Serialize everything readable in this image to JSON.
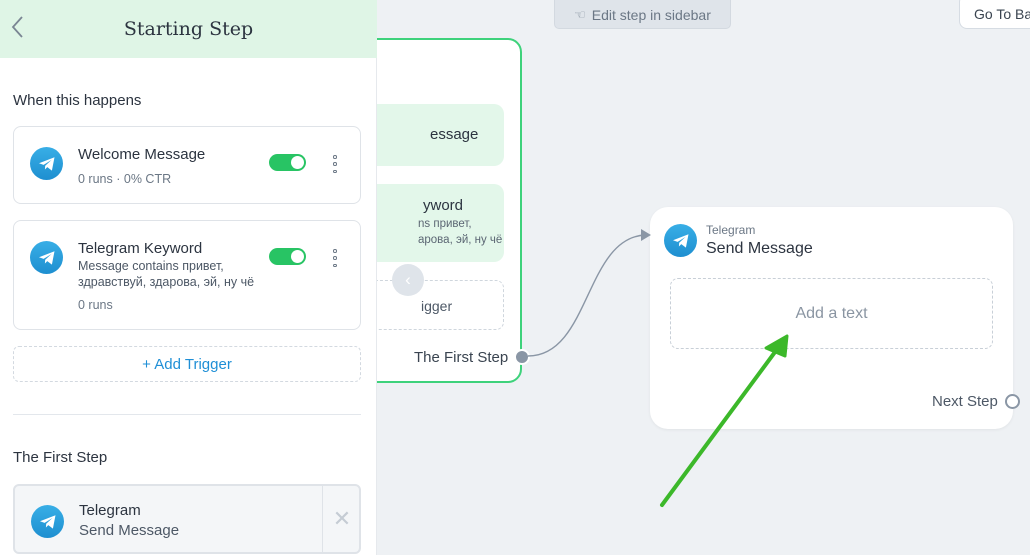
{
  "sidebar": {
    "title": "Starting Step",
    "back_icon": "chevron-left-icon",
    "when_label": "When this happens",
    "triggers": [
      {
        "name": "Welcome Message",
        "runs": "0 runs",
        "ctr": "0% CTR",
        "enabled": true
      },
      {
        "name": "Telegram Keyword",
        "description": "Message contains привет, здравствуй, здарова, эй, ну чё",
        "runs": "0 runs",
        "enabled": true
      }
    ],
    "add_trigger_label": "+ Add Trigger",
    "first_step_heading": "The First Step",
    "first_step_card": {
      "title": "Telegram",
      "subtitle": "Send Message",
      "remove_icon": "close-icon"
    }
  },
  "canvas": {
    "edit_hint": "Edit step in sidebar",
    "goto_button": "Go To Ba",
    "start_card": {
      "trigger_1_fragment": "essage",
      "trigger_2_fragment": "yword",
      "trigger_2_desc_fragment": "ns привет,\nарова, эй, ну чё",
      "add_trigger_fragment": "igger",
      "first_step_label": "The First Step"
    },
    "send_node": {
      "channel": "Telegram",
      "title": "Send Message",
      "placeholder": "Add a text",
      "next_step_label": "Next Step"
    }
  },
  "colors": {
    "accent_green": "#28c464",
    "header_green": "#dff5e6",
    "link_blue": "#1f8fd6",
    "telegram_blue": "#2aa3df",
    "annotation_arrow": "#3cb82a"
  },
  "separator": "·"
}
